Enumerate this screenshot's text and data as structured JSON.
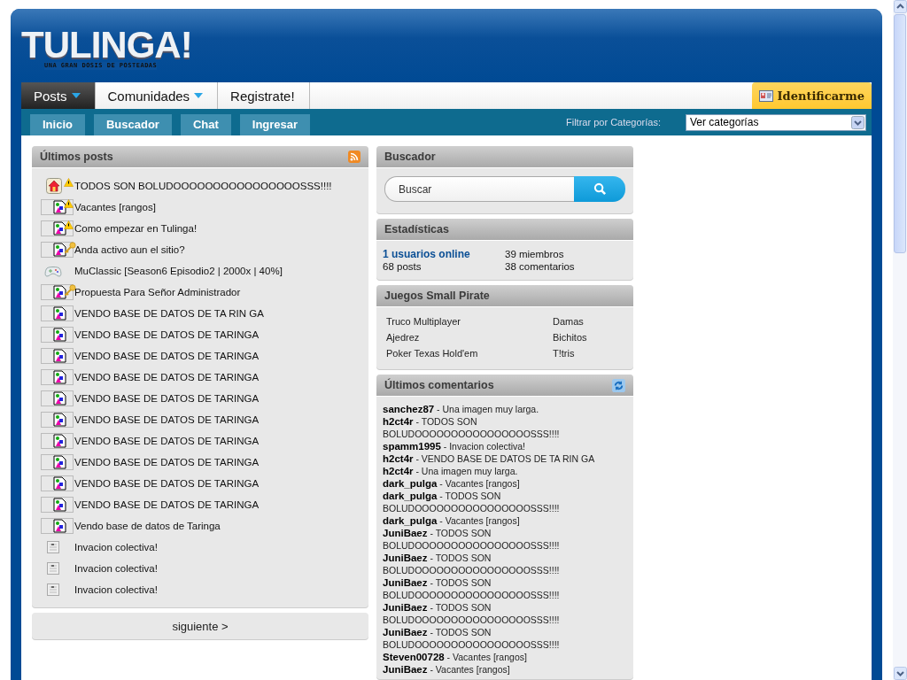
{
  "logo": {
    "title": "TULINGA!",
    "tagline": "UNA GRAN DOSIS DE POSTEADAS"
  },
  "nav": {
    "tabs": [
      {
        "label": "Posts",
        "dropdown": true,
        "selected": true
      },
      {
        "label": "Comunidades",
        "dropdown": true,
        "selected": false
      },
      {
        "label": "Registrate!",
        "dropdown": false,
        "selected": false
      }
    ],
    "login": "Identificarme"
  },
  "subnav": {
    "links": [
      "Inicio",
      "Buscador",
      "Chat",
      "Ingresar"
    ],
    "filter_label": "Filtrar por Categorías:",
    "filter_value": "Ver categorías"
  },
  "latest_posts": {
    "title": "Últimos posts",
    "items": [
      {
        "kind": "home",
        "warning": true,
        "key": false,
        "title": "TODOS SON BOLUDOOOOOOOOOOOOOOOOSSS!!!!"
      },
      {
        "kind": "broken",
        "warning": true,
        "key": false,
        "title": "Vacantes [rangos]"
      },
      {
        "kind": "broken",
        "warning": true,
        "key": false,
        "title": "Como empezar en Tulinga!"
      },
      {
        "kind": "broken",
        "warning": false,
        "key": true,
        "title": "Anda activo aun el sitio?"
      },
      {
        "kind": "game",
        "warning": false,
        "key": false,
        "title": "MuClassic [Season6 Episodio2 | 2000x | 40%]"
      },
      {
        "kind": "broken",
        "warning": false,
        "key": true,
        "title": "Propuesta Para Señor Administrador"
      },
      {
        "kind": "broken",
        "warning": false,
        "key": false,
        "title": "VENDO BASE DE DATOS DE TA RIN GA"
      },
      {
        "kind": "broken",
        "warning": false,
        "key": false,
        "title": "VENDO BASE DE DATOS DE TARINGA"
      },
      {
        "kind": "broken",
        "warning": false,
        "key": false,
        "title": "VENDO BASE DE DATOS DE TARINGA"
      },
      {
        "kind": "broken",
        "warning": false,
        "key": false,
        "title": "VENDO BASE DE DATOS DE TARINGA"
      },
      {
        "kind": "broken",
        "warning": false,
        "key": false,
        "title": "VENDO BASE DE DATOS DE TARINGA"
      },
      {
        "kind": "broken",
        "warning": false,
        "key": false,
        "title": "VENDO BASE DE DATOS DE TARINGA"
      },
      {
        "kind": "broken",
        "warning": false,
        "key": false,
        "title": "VENDO BASE DE DATOS DE TARINGA"
      },
      {
        "kind": "broken",
        "warning": false,
        "key": false,
        "title": "VENDO BASE DE DATOS DE TARINGA"
      },
      {
        "kind": "broken",
        "warning": false,
        "key": false,
        "title": "VENDO BASE DE DATOS DE TARINGA"
      },
      {
        "kind": "broken",
        "warning": false,
        "key": false,
        "title": "VENDO BASE DE DATOS DE TARINGA"
      },
      {
        "kind": "broken",
        "warning": false,
        "key": false,
        "title": "Vendo base de datos de Taringa"
      },
      {
        "kind": "note",
        "warning": false,
        "key": false,
        "title": "Invacion colectiva!"
      },
      {
        "kind": "note",
        "warning": false,
        "key": false,
        "title": "Invacion colectiva!"
      },
      {
        "kind": "note",
        "warning": false,
        "key": false,
        "title": "Invacion colectiva!"
      }
    ],
    "next": "siguiente >"
  },
  "search": {
    "title": "Buscador",
    "placeholder": "Buscar"
  },
  "stats": {
    "title": "Estadísticas",
    "online": "1 usuarios online",
    "members": "39 miembros",
    "posts": "68 posts",
    "comments": "38 comentarios"
  },
  "games": {
    "title": "Juegos Small Pirate",
    "items": [
      "Truco Multiplayer",
      "Damas",
      "Ajedrez",
      "Bichitos",
      "Poker Texas Hold'em",
      "T!tris"
    ]
  },
  "latest_comments": {
    "title": "Últimos comentarios",
    "items": [
      {
        "user": "sanchez87",
        "text": "- Una imagen muy larga."
      },
      {
        "user": "h2ct4r",
        "text": "- TODOS SON BOLUDOOOOOOOOOOOOOOOOSSS!!!!"
      },
      {
        "user": "spamm1995",
        "text": "- Invacion colectiva!"
      },
      {
        "user": "h2ct4r",
        "text": "- VENDO BASE DE DATOS DE TA RIN GA"
      },
      {
        "user": "h2ct4r",
        "text": "- Una imagen muy larga."
      },
      {
        "user": "dark_pulga",
        "text": "- Vacantes [rangos]"
      },
      {
        "user": "dark_pulga",
        "text": "- TODOS SON BOLUDOOOOOOOOOOOOOOOOSSS!!!!"
      },
      {
        "user": "dark_pulga",
        "text": "- Vacantes [rangos]"
      },
      {
        "user": "JuniBaez",
        "text": "- TODOS SON BOLUDOOOOOOOOOOOOOOOOSSS!!!!"
      },
      {
        "user": "JuniBaez",
        "text": "- TODOS SON BOLUDOOOOOOOOOOOOOOOOSSS!!!!"
      },
      {
        "user": "JuniBaez",
        "text": "- TODOS SON BOLUDOOOOOOOOOOOOOOOOSSS!!!!"
      },
      {
        "user": "JuniBaez",
        "text": "- TODOS SON BOLUDOOOOOOOOOOOOOOOOSSS!!!!"
      },
      {
        "user": "JuniBaez",
        "text": "- TODOS SON BOLUDOOOOOOOOOOOOOOOOSSS!!!!"
      },
      {
        "user": "Steven00728",
        "text": "- Vacantes [rangos]"
      },
      {
        "user": "JuniBaez",
        "text": "- Vacantes [rangos]"
      }
    ]
  }
}
